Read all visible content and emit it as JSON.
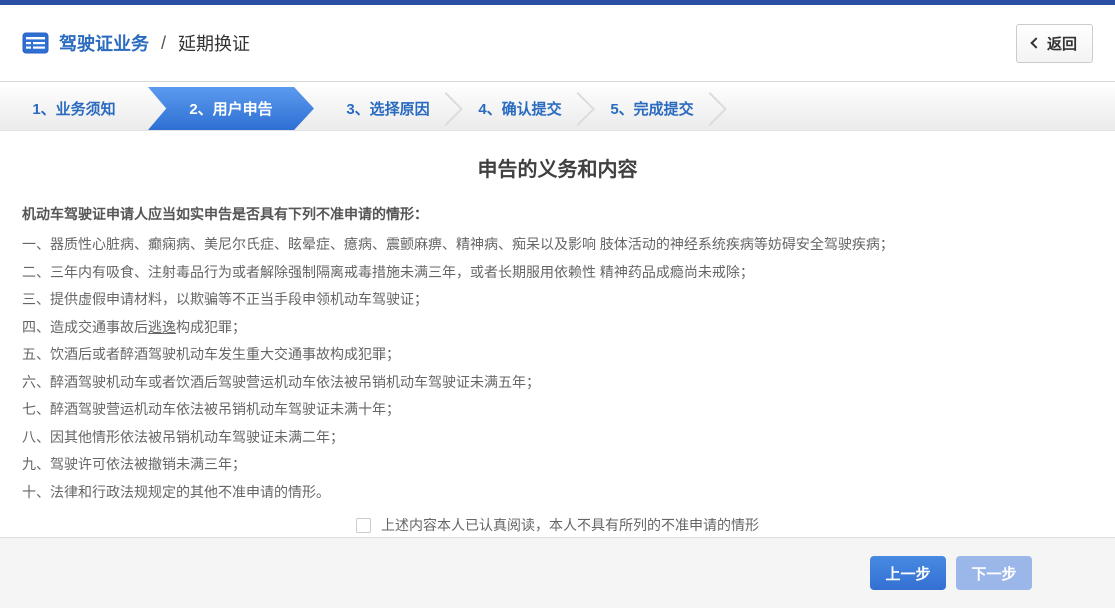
{
  "header": {
    "title": "驾驶证业务",
    "separator": "/",
    "subtitle": "延期换证",
    "back_label": "返回"
  },
  "steps": [
    {
      "label": "1、业务须知",
      "active": false
    },
    {
      "label": "2、用户申告",
      "active": true
    },
    {
      "label": "3、选择原因",
      "active": false
    },
    {
      "label": "4、确认提交",
      "active": false
    },
    {
      "label": "5、完成提交",
      "active": false
    }
  ],
  "main": {
    "title": "申告的义务和内容",
    "intro": "机动车驾驶证申请人应当如实申告是否具有下列不准申请的情形：",
    "items": [
      {
        "text": "一、器质性心脏病、癫痫病、美尼尔氏症、眩晕症、癔病、震颤麻痹、精神病、痴呆以及影响 肢体活动的神经系统疾病等妨碍安全驾驶疾病；"
      },
      {
        "text": "二、三年内有吸食、注射毒品行为或者解除强制隔离戒毒措施未满三年，或者长期服用依赖性 精神药品成瘾尚未戒除；"
      },
      {
        "text": "三、提供虚假申请材料，以欺骗等不正当手段申领机动车驾驶证；"
      },
      {
        "text": "四、造成交通事故后逃逸构成犯罪；",
        "underline_word": "逃逸"
      },
      {
        "text": "五、饮酒后或者醉酒驾驶机动车发生重大交通事故构成犯罪；"
      },
      {
        "text": "六、醉酒驾驶机动车或者饮酒后驾驶营运机动车依法被吊销机动车驾驶证未满五年；"
      },
      {
        "text": "七、醉酒驾驶营运机动车依法被吊销机动车驾驶证未满十年；"
      },
      {
        "text": "八、因其他情形依法被吊销机动车驾驶证未满二年；"
      },
      {
        "text": "九、驾驶许可依法被撤销未满三年；"
      },
      {
        "text": "十、法律和行政法规规定的其他不准申请的情形。"
      }
    ],
    "agree": {
      "checked": false,
      "label": "上述内容本人已认真阅读，本人不具有所列的不准申请的情形"
    }
  },
  "footer": {
    "prev_label": "上一步",
    "next_label": "下一步",
    "next_disabled": true
  },
  "colors": {
    "topbar_blue": "#2b4fa2",
    "link_blue": "#2a6bc0",
    "active_step_top": "#5b9bee",
    "active_step_bottom": "#2e6fd4",
    "prev_button_blue": "#3d7dda",
    "next_button_disabled": "#9bb7ea",
    "footer_bg": "#f5f5f5",
    "body_text": "#666666"
  }
}
